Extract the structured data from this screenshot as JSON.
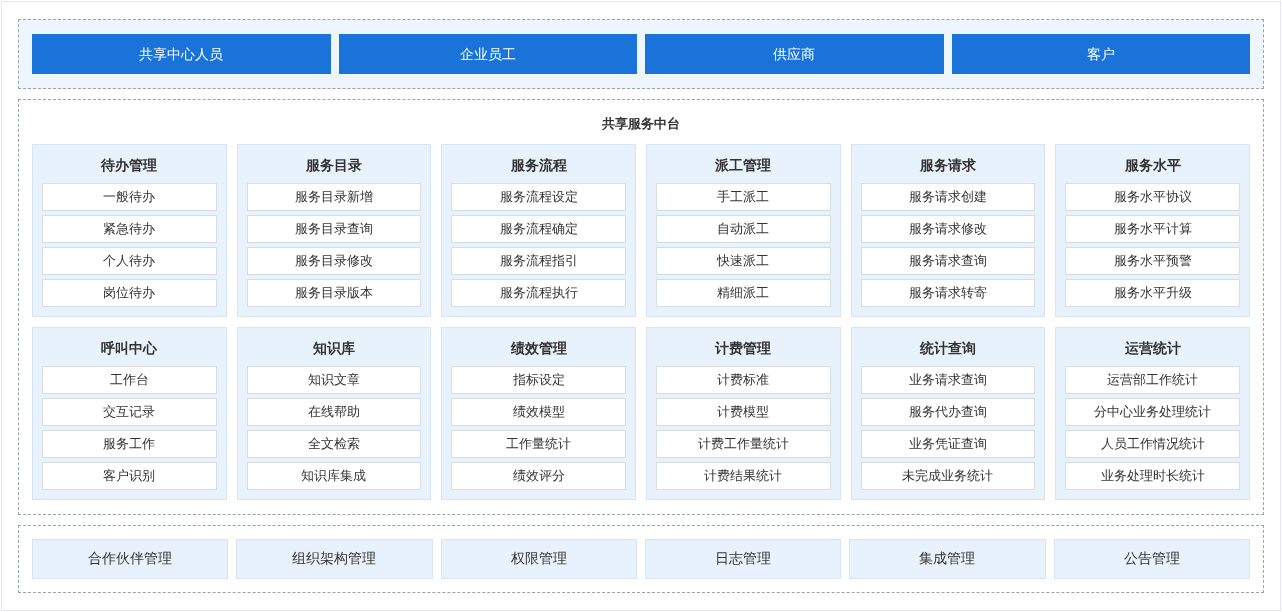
{
  "user_roles": [
    "共享中心人员",
    "企业员工",
    "供应商",
    "客户"
  ],
  "platform": {
    "title": "共享服务中台",
    "modules": [
      {
        "title": "待办管理",
        "items": [
          "一般待办",
          "紧急待办",
          "个人待办",
          "岗位待办"
        ]
      },
      {
        "title": "服务目录",
        "items": [
          "服务目录新增",
          "服务目录查询",
          "服务目录修改",
          "服务目录版本"
        ]
      },
      {
        "title": "服务流程",
        "items": [
          "服务流程设定",
          "服务流程确定",
          "服务流程指引",
          "服务流程执行"
        ]
      },
      {
        "title": "派工管理",
        "items": [
          "手工派工",
          "自动派工",
          "快速派工",
          "精细派工"
        ]
      },
      {
        "title": "服务请求",
        "items": [
          "服务请求创建",
          "服务请求修改",
          "服务请求查询",
          "服务请求转寄"
        ]
      },
      {
        "title": "服务水平",
        "items": [
          "服务水平协议",
          "服务水平计算",
          "服务水平预警",
          "服务水平升级"
        ]
      },
      {
        "title": "呼叫中心",
        "items": [
          "工作台",
          "交互记录",
          "服务工作",
          "客户识别"
        ]
      },
      {
        "title": "知识库",
        "items": [
          "知识文章",
          "在线帮助",
          "全文检索",
          "知识库集成"
        ]
      },
      {
        "title": "绩效管理",
        "items": [
          "指标设定",
          "绩效模型",
          "工作量统计",
          "绩效评分"
        ]
      },
      {
        "title": "计费管理",
        "items": [
          "计费标准",
          "计费模型",
          "计费工作量统计",
          "计费结果统计"
        ]
      },
      {
        "title": "统计查询",
        "items": [
          "业务请求查询",
          "服务代办查询",
          "业务凭证查询",
          "未完成业务统计"
        ]
      },
      {
        "title": "运营统计",
        "items": [
          "运营部工作统计",
          "分中心业务处理统计",
          "人员工作情况统计",
          "业务处理时长统计"
        ]
      }
    ]
  },
  "base_services": [
    "合作伙伴管理",
    "组织架构管理",
    "权限管理",
    "日志管理",
    "集成管理",
    "公告管理"
  ]
}
